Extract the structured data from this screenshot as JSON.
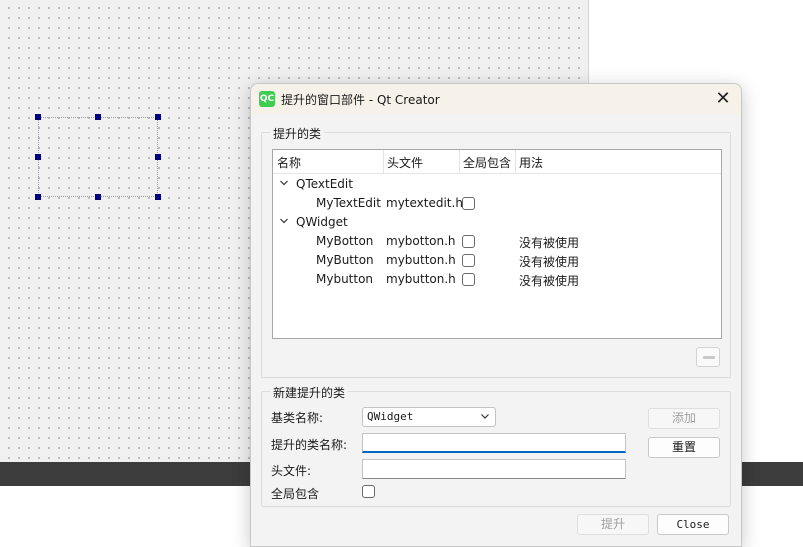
{
  "dialog": {
    "icon_text": "QC",
    "title": "提升的窗口部件 - Qt Creator",
    "close_glyph": "✕"
  },
  "promoted_group": {
    "title": "提升的类",
    "columns": [
      "名称",
      "头文件",
      "全局包含",
      "用法"
    ],
    "tree": [
      {
        "label": "QTextEdit",
        "children": [
          {
            "name": "MyTextEdit",
            "header": "mytextedit.h",
            "global": false,
            "usage": ""
          }
        ]
      },
      {
        "label": "QWidget",
        "children": [
          {
            "name": "MyBotton",
            "header": "mybotton.h",
            "global": false,
            "usage": "没有被使用"
          },
          {
            "name": "MyButton",
            "header": "mybutton.h",
            "global": false,
            "usage": "没有被使用"
          },
          {
            "name": "Mybutton",
            "header": "mybutton.h",
            "global": false,
            "usage": "没有被使用"
          }
        ]
      }
    ],
    "remove_icon": "minus-icon"
  },
  "new_group": {
    "title": "新建提升的类",
    "base_class_label": "基类名称:",
    "base_class_value": "QWidget",
    "class_name_label": "提升的类名称:",
    "class_name_value": "",
    "header_label": "头文件:",
    "header_value": "",
    "global_label": "全局包含",
    "global_checked": false,
    "add_label": "添加",
    "reset_label": "重置"
  },
  "footer": {
    "promote_label": "提升",
    "close_label": "Close"
  },
  "colors": {
    "handle": "#000080",
    "accent": "#0067c0",
    "qt_green": "#41cd52"
  }
}
